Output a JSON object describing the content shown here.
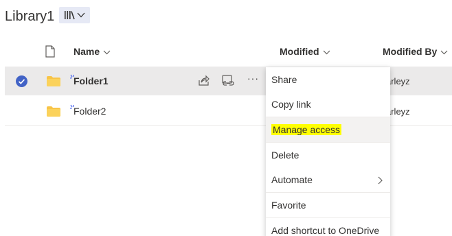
{
  "library": {
    "title": "Library1",
    "view_icon": "library-view-icon"
  },
  "columns": {
    "file_type_icon": "document-icon",
    "name": "Name",
    "modified": "Modified",
    "modified_by": "Modified By"
  },
  "rows": [
    {
      "name": "Folder1",
      "selected": true,
      "modified_by": "arleyz",
      "icon": "folder-icon"
    },
    {
      "name": "Folder2",
      "selected": false,
      "modified_by": "arleyz",
      "icon": "folder-icon"
    }
  ],
  "row_actions": {
    "share_icon": "share-icon",
    "copy_link_icon": "copy-link-icon",
    "more": "···"
  },
  "context_menu": {
    "items": [
      {
        "label": "Share"
      },
      {
        "label": "Copy link"
      },
      {
        "label": "Manage access",
        "highlighted": true
      },
      {
        "label": "Delete"
      },
      {
        "label": "Automate",
        "has_submenu": true
      },
      {
        "label": "Favorite"
      },
      {
        "label": "Add shortcut to OneDrive"
      }
    ]
  },
  "colors": {
    "accent": "#4263c6",
    "folder": "#f8c447",
    "selected_row": "#ebeaea",
    "highlight": "#ffff00",
    "view_switch_bg": "#e6e9f5"
  }
}
